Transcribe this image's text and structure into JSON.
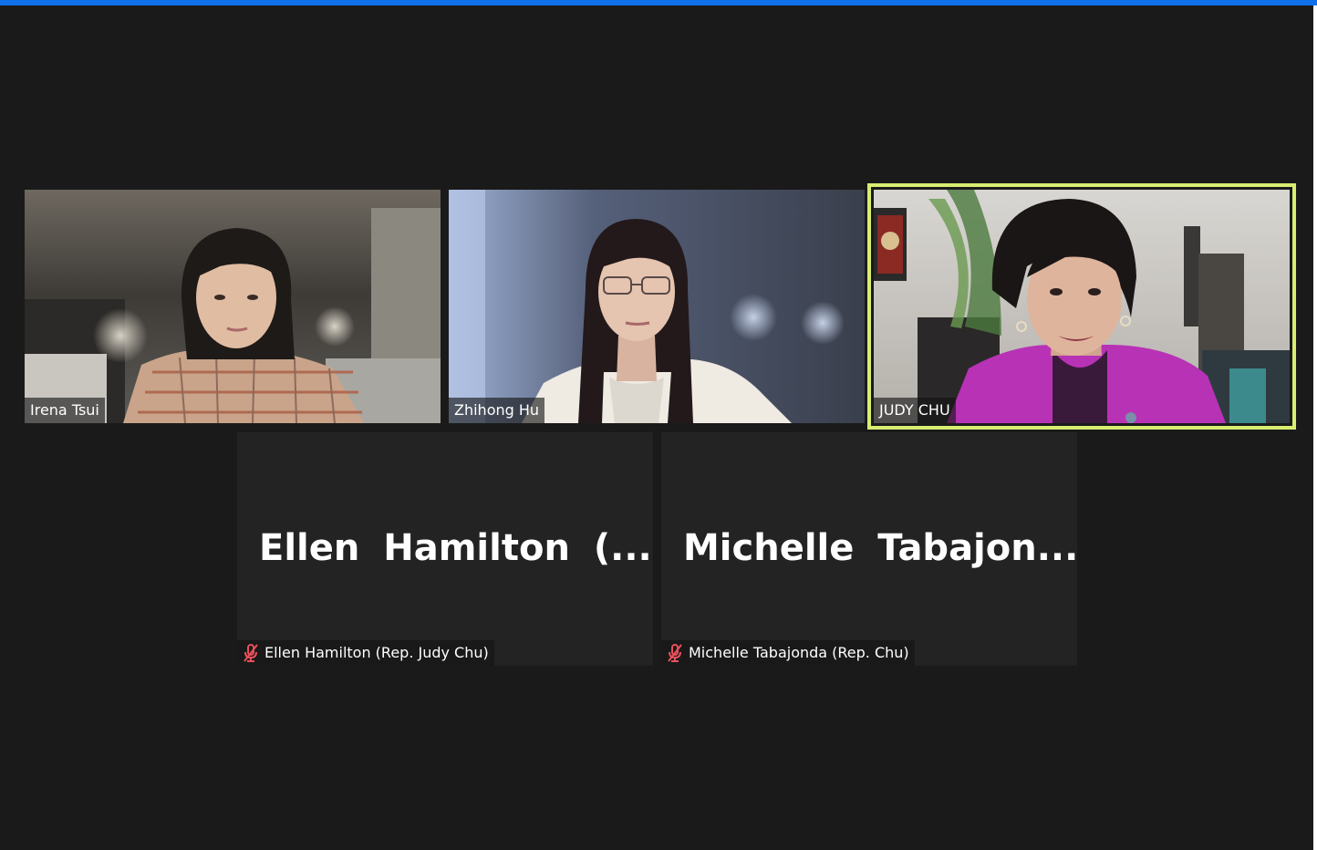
{
  "colors": {
    "background": "#1a1a1a",
    "top_bar": "#0e71eb",
    "active_speaker_outline": "#d7ee71",
    "muted_icon": "#e8505b"
  },
  "participants": [
    {
      "name": "Irena Tsui",
      "video_on": true,
      "muted": false,
      "active_speaker": false
    },
    {
      "name": "Zhihong Hu",
      "video_on": true,
      "muted": false,
      "active_speaker": false
    },
    {
      "name": "JUDY CHU",
      "video_on": true,
      "muted": false,
      "active_speaker": true
    },
    {
      "name": "Ellen Hamilton (Rep. Judy Chu)",
      "display_name": "Ellen Hamilton (...",
      "video_on": false,
      "muted": true,
      "mute_icon": "microphone-muted-icon",
      "active_speaker": false
    },
    {
      "name": "Michelle Tabajonda (Rep. Chu)",
      "display_name": "Michelle Tabajon...",
      "video_on": false,
      "muted": true,
      "mute_icon": "microphone-muted-icon",
      "active_speaker": false
    }
  ]
}
